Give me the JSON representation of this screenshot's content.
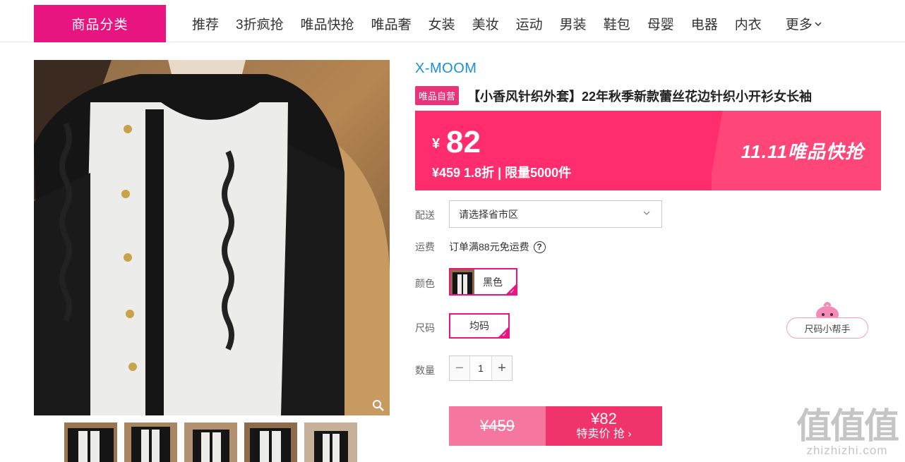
{
  "nav": {
    "category_label": "商品分类",
    "items": [
      "推荐",
      "3折疯抢",
      "唯品快抢",
      "唯品奢",
      "女装",
      "美妆",
      "运动",
      "男装",
      "鞋包",
      "母婴",
      "电器",
      "内衣"
    ],
    "more_label": "更多"
  },
  "product": {
    "brand": "X-MOOM",
    "self_badge": "唯品自营",
    "title": "【小香风针织外套】22年秋季新款蕾丝花边针织小开衫女长袖"
  },
  "price": {
    "currency": "¥",
    "value": "82",
    "sub": "¥459 1.8折 | 限量5000件",
    "promo_logo": "11.11唯品快抢"
  },
  "options": {
    "delivery_label": "配送",
    "delivery_placeholder": "请选择省市区",
    "shipping_label": "运费",
    "shipping_text": "订单满88元免运费",
    "help_glyph": "?",
    "color_label": "颜色",
    "color_value": "黑色",
    "size_label": "尺码",
    "size_value": "均码",
    "size_helper": "尺码小帮手",
    "qty_label": "数量",
    "qty_minus": "−",
    "qty_value": "1",
    "qty_plus": "+"
  },
  "buy": {
    "original_price": "¥459",
    "sale_price": "¥82",
    "action": "特卖价 抢 ›"
  },
  "watermark": {
    "mark": "值值值",
    "site": "zhizhizhi.com"
  },
  "colors": {
    "brand_pink": "#e8147f",
    "banner_pink": "#ff2d6e",
    "brand_blue": "#1b8fd6"
  }
}
